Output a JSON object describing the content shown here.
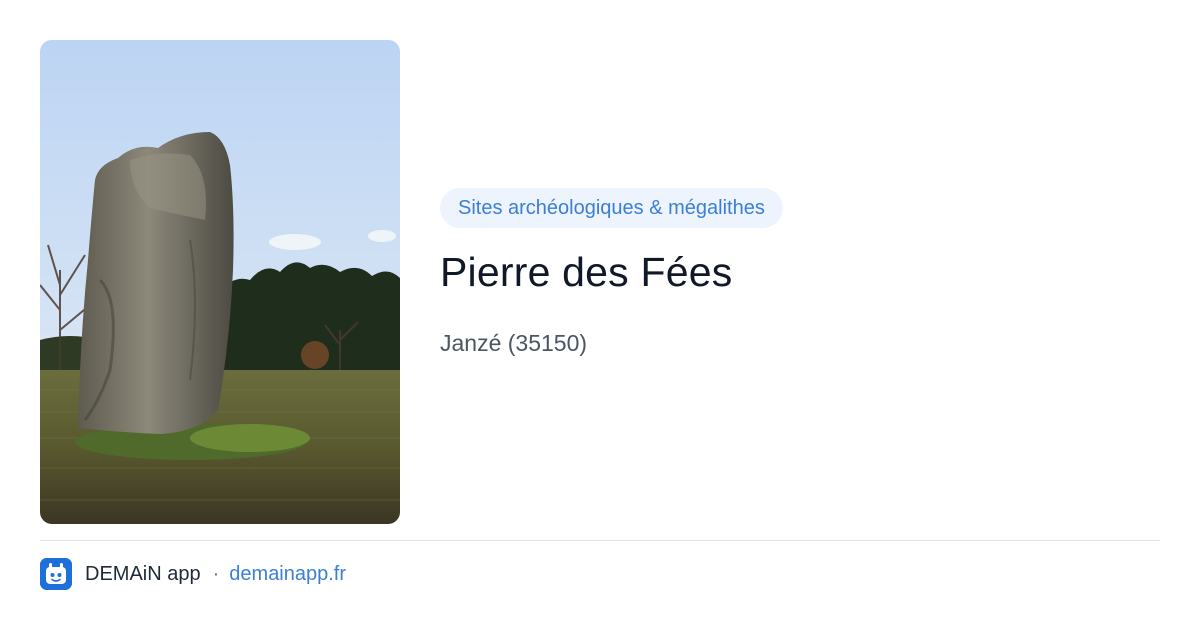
{
  "place": {
    "category": "Sites archéologiques & mégalithes",
    "title": "Pierre des Fées",
    "location": "Janzé (35150)"
  },
  "footer": {
    "app_name": "DEMAiN app",
    "separator": "·",
    "url": "demainapp.fr"
  },
  "colors": {
    "accent": "#3b7fd4",
    "badge_bg": "#eef4fd",
    "title": "#111827",
    "muted": "#4b5563",
    "divider": "#dbe3ea",
    "logo_bg": "#1e6fd9"
  },
  "icons": {
    "app_logo": "demain-logo-icon"
  }
}
